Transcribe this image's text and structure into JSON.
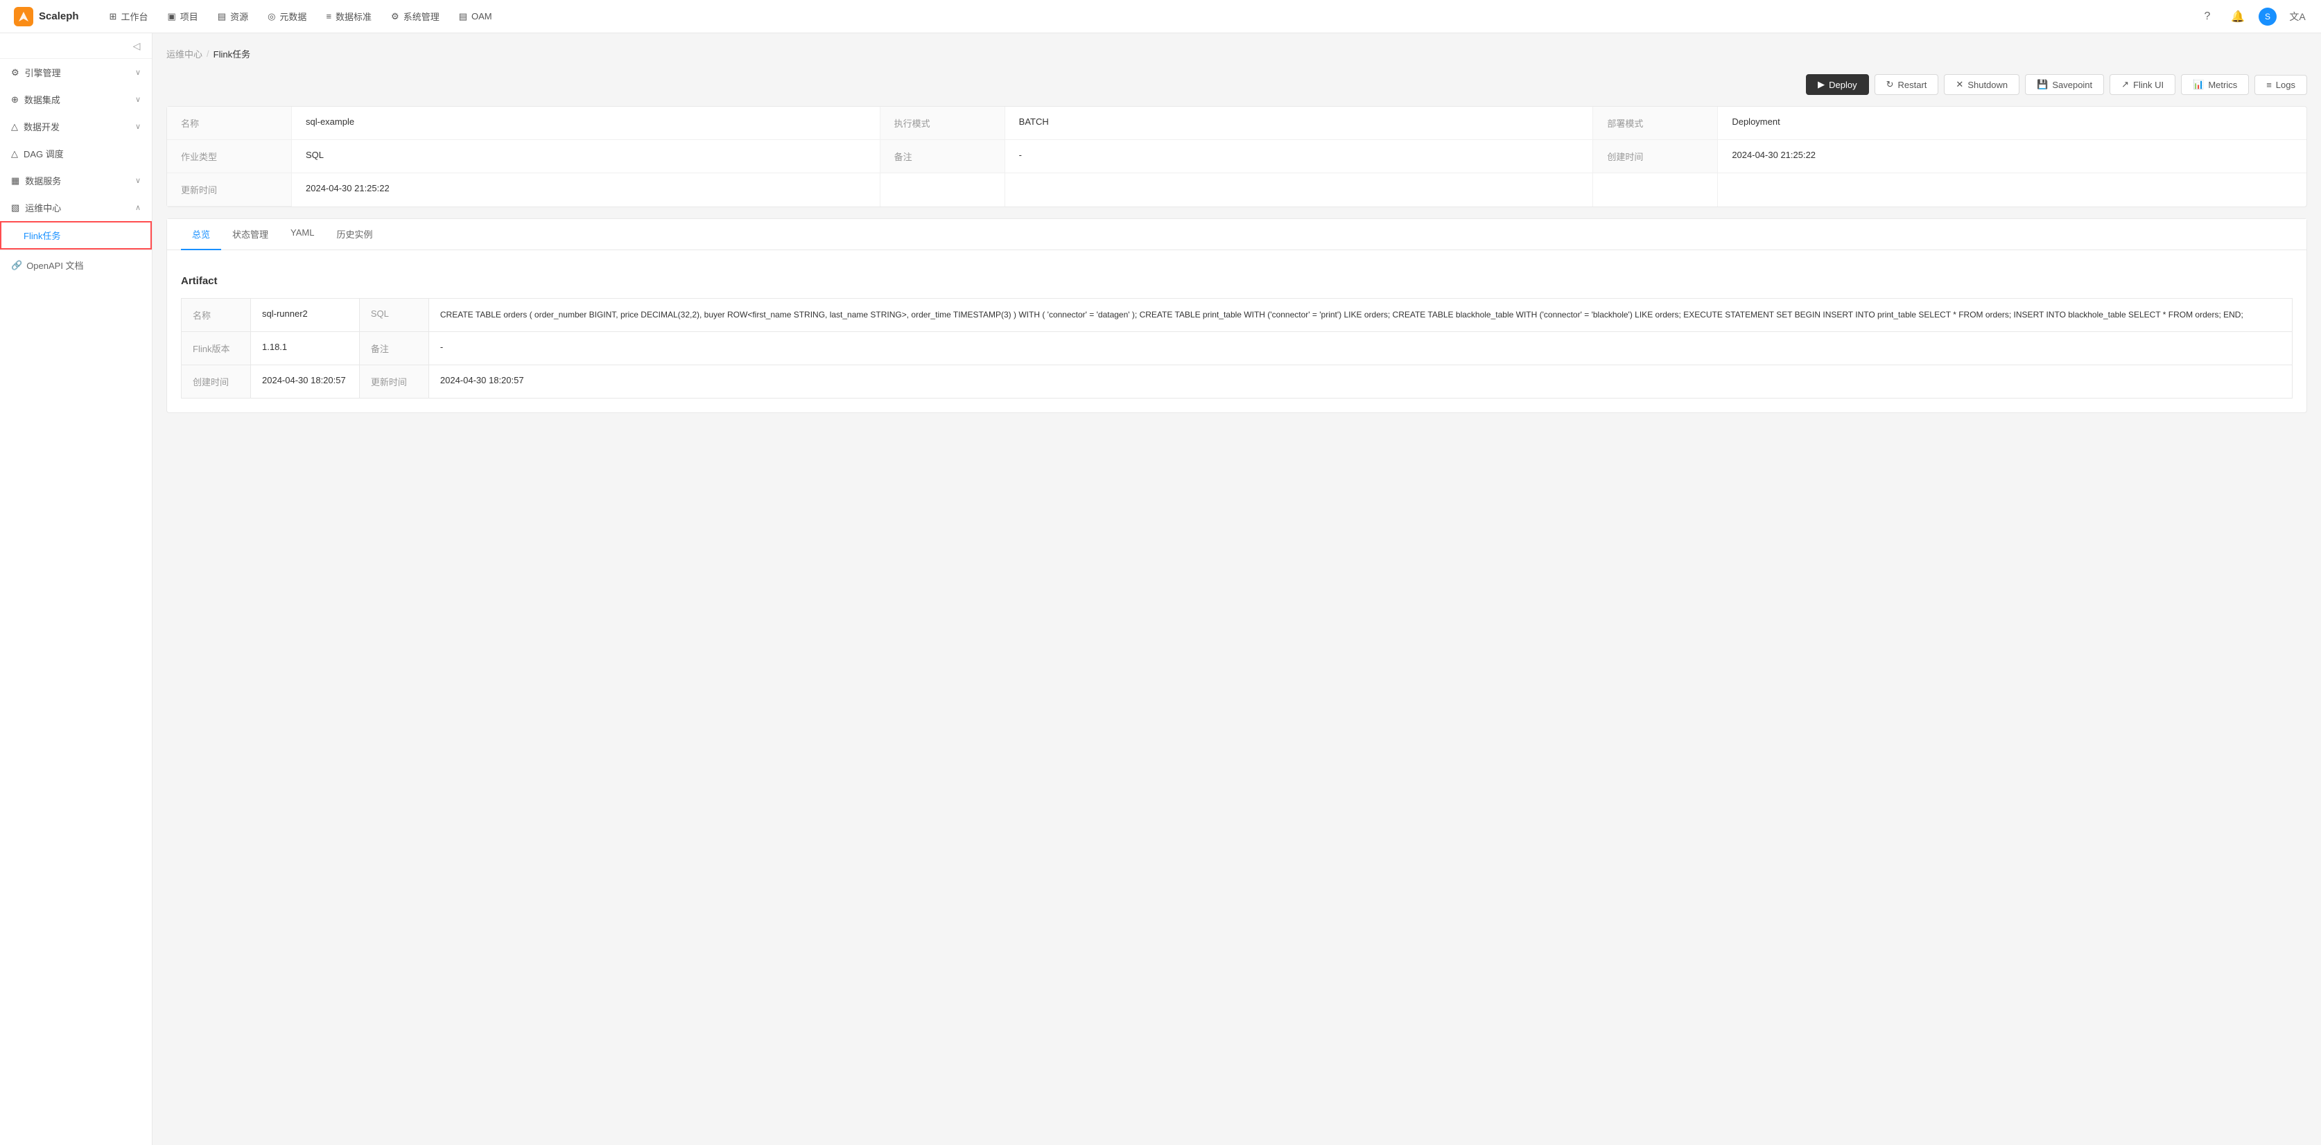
{
  "app": {
    "logo_text": "Scaleph"
  },
  "top_nav": {
    "items": [
      {
        "icon": "⊞",
        "label": "工作台"
      },
      {
        "icon": "▣",
        "label": "项目"
      },
      {
        "icon": "▤",
        "label": "资源"
      },
      {
        "icon": "◎",
        "label": "元数据"
      },
      {
        "icon": "≡",
        "label": "数据标准"
      },
      {
        "icon": "⚙",
        "label": "系统管理"
      },
      {
        "icon": "▤",
        "label": "OAM"
      }
    ]
  },
  "breadcrumb": {
    "parent": "运维中心",
    "separator": "/",
    "current": "Flink任务"
  },
  "toolbar": {
    "deploy_label": "Deploy",
    "restart_label": "Restart",
    "shutdown_label": "Shutdown",
    "savepoint_label": "Savepoint",
    "flink_ui_label": "Flink UI",
    "metrics_label": "Metrics",
    "logs_label": "Logs"
  },
  "info": {
    "fields": [
      {
        "label": "名称",
        "value": "sql-example"
      },
      {
        "label": "执行模式",
        "value": "BATCH"
      },
      {
        "label": "部署模式",
        "value": "Deployment"
      },
      {
        "label": "作业类型",
        "value": "SQL"
      },
      {
        "label": "备注",
        "value": "-"
      },
      {
        "label": "创建时间",
        "value": "2024-04-30 21:25:22"
      },
      {
        "label": "更新时间",
        "value": "2024-04-30 21:25:22"
      }
    ]
  },
  "tabs": [
    {
      "id": "overview",
      "label": "总览",
      "active": true
    },
    {
      "id": "state",
      "label": "状态管理"
    },
    {
      "id": "yaml",
      "label": "YAML"
    },
    {
      "id": "history",
      "label": "历史实例"
    }
  ],
  "artifact": {
    "section_title": "Artifact",
    "rows": [
      {
        "label1": "名称",
        "value1": "sql-runner2",
        "label2": "SQL",
        "value2": "CREATE TABLE orders ( order_number BIGINT, price DECIMAL(32,2), buyer ROW<first_name STRING, last_name STRING>, order_time TIMESTAMP(3) ) WITH ( 'connector' = 'datagen' ); CREATE TABLE print_table WITH ('connector' = 'print') LIKE orders; CREATE TABLE blackhole_table WITH ('connector' = 'blackhole') LIKE orders; EXECUTE STATEMENT SET BEGIN INSERT INTO print_table SELECT * FROM orders; INSERT INTO blackhole_table SELECT * FROM orders; END;"
      },
      {
        "label1": "Flink版本",
        "value1": "1.18.1",
        "label2": "备注",
        "value2": "-"
      },
      {
        "label1": "创建时间",
        "value1": "2024-04-30 18:20:57",
        "label2": "更新时间",
        "value2": "2024-04-30 18:20:57"
      }
    ]
  },
  "sidebar": {
    "collapse_tooltip": "折叠",
    "groups": [
      {
        "id": "engine",
        "icon": "⚙",
        "label": "引擎管理",
        "expanded": false,
        "items": []
      },
      {
        "id": "integration",
        "icon": "⊕",
        "label": "数据集成",
        "expanded": false,
        "items": []
      },
      {
        "id": "devops",
        "icon": "△",
        "label": "数据开发",
        "expanded": false,
        "items": []
      },
      {
        "id": "dag",
        "icon": "△",
        "label": "DAG 调度",
        "expanded": false,
        "items": []
      },
      {
        "id": "data-service",
        "icon": "▦",
        "label": "数据服务",
        "expanded": false,
        "items": []
      },
      {
        "id": "ops",
        "icon": "▧",
        "label": "运维中心",
        "expanded": true,
        "items": [
          {
            "id": "flink-jobs",
            "label": "Flink任务",
            "active": true
          }
        ]
      }
    ],
    "bottom_link": "OpenAPI 文档"
  }
}
